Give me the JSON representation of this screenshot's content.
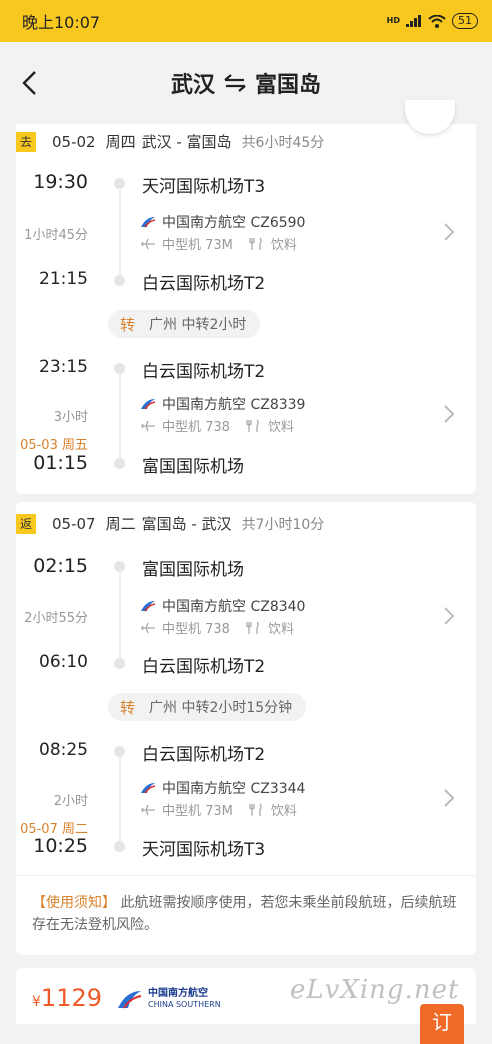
{
  "status_bar": {
    "time": "晚上10:07",
    "signal_label": "HD",
    "battery": "51"
  },
  "nav": {
    "origin": "武汉",
    "destination": "富国岛"
  },
  "outbound": {
    "tag": "去",
    "date": "05-02",
    "weekday": "周四",
    "route": "武汉 - 富国岛",
    "total_duration": "共6小时45分",
    "legs": [
      {
        "dep_time": "19:30",
        "dep_airport": "天河国际机场T3",
        "duration": "1小时45分",
        "airline": "中国南方航空 CZ6590",
        "aircraft": "中型机 73M",
        "meal": "饮料",
        "arr_time": "21:15",
        "arr_airport": "白云国际机场T2",
        "arr_date": ""
      },
      {
        "dep_time": "23:15",
        "dep_airport": "白云国际机场T2",
        "duration": "3小时",
        "airline": "中国南方航空 CZ8339",
        "aircraft": "中型机 738",
        "meal": "饮料",
        "arr_time": "01:15",
        "arr_airport": "富国国际机场",
        "arr_date": "05-03 周五"
      }
    ],
    "transfer": {
      "tag": "转",
      "text": "广州 中转2小时"
    }
  },
  "return": {
    "tag": "返",
    "date": "05-07",
    "weekday": "周二",
    "route": "富国岛 - 武汉",
    "total_duration": "共7小时10分",
    "legs": [
      {
        "dep_time": "02:15",
        "dep_airport": "富国国际机场",
        "duration": "2小时55分",
        "airline": "中国南方航空 CZ8340",
        "aircraft": "中型机 738",
        "meal": "饮料",
        "arr_time": "06:10",
        "arr_airport": "白云国际机场T2",
        "arr_date": ""
      },
      {
        "dep_time": "08:25",
        "dep_airport": "白云国际机场T2",
        "duration": "2小时",
        "airline": "中国南方航空 CZ3344",
        "aircraft": "中型机 73M",
        "meal": "饮料",
        "arr_time": "10:25",
        "arr_airport": "天河国际机场T3",
        "arr_date": "05-07 周二"
      }
    ],
    "transfer": {
      "tag": "转",
      "text": "广州 中转2小时15分钟"
    }
  },
  "notice": {
    "label": "【使用须知】",
    "text": " 此航班需按顺序使用，若您未乘坐前段航班，后续航班存在无法登机风险。"
  },
  "bottom": {
    "currency": "¥",
    "price": "1129",
    "airline_logo_cn": "中国南方航空",
    "airline_logo_en": "CHINA SOUTHERN",
    "book_label": "订"
  },
  "watermark": "eLvXing.net",
  "colors": {
    "accent_yellow": "#f8c81e",
    "accent_orange": "#d9822b",
    "price_red": "#f05a28",
    "brand_blue": "#1b3d8e"
  }
}
